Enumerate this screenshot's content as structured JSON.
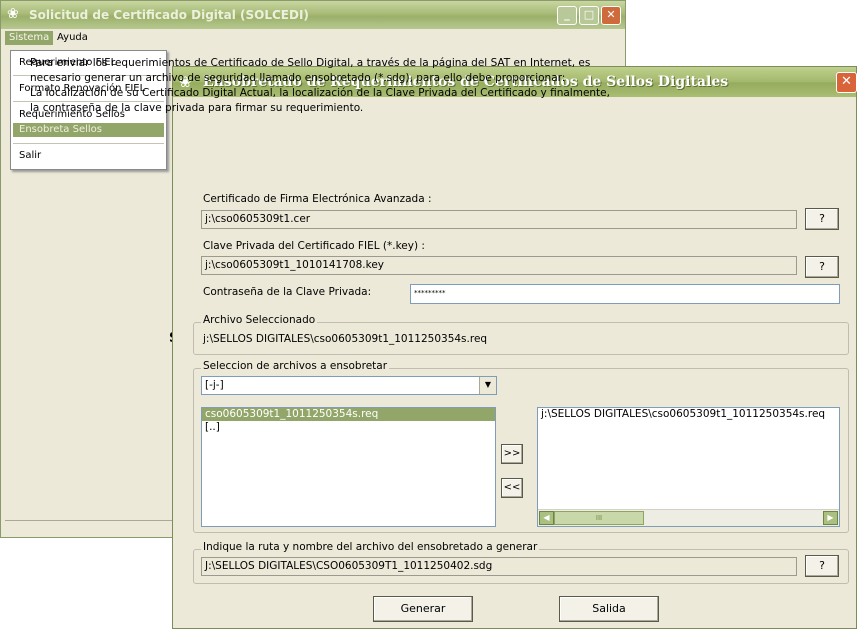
{
  "background_window": {
    "title": "Solicitud de Certificado Digital (SOLCEDI)",
    "menu": [
      {
        "label": "Sistema"
      },
      {
        "label": "Ayuda"
      }
    ],
    "dropdown_items": [
      {
        "label": "Requerimiento FIEL"
      },
      {
        "label": "Formato Renovación FIEL"
      },
      {
        "label": "Requerimiento Sellos"
      },
      {
        "label": "Ensobreta Sellos"
      },
      {
        "label": "Salir"
      }
    ],
    "stray_text": "S"
  },
  "dialog": {
    "title": "Ensobretado de Requerimientos de Certificados de Sellos Digitales",
    "description_lines": [
      "Para enviar  los requerimientos  de Certificado de Sello  Digital, a través de la página del SAT en  Internet, es",
      "necesario generar un archivo de seguridad llamado ensobretado (*.sdg),  para ello debe proporcionar:",
      "La localización de su Certificado Digital Actual, la localización de la Clave Privada  del Certificado y finalmente,",
      "la contraseña de la clave privada para firmar su requerimiento."
    ],
    "cert_label": "Certificado de Firma Electrónica Avanzada :",
    "cert_value": "j:\\cso0605309t1.cer",
    "key_label": "Clave Privada del Certificado FIEL (*.key) :",
    "key_value": "j:\\cso0605309t1_1010141708.key",
    "password_label": "Contraseña de la Clave Privada:",
    "password_value": "*********",
    "browse_label": "?",
    "selected_group_title": "Archivo Seleccionado",
    "selected_file": "j:\\SELLOS DIGITALES\\cso0605309t1_1011250354s.req",
    "selection_group_title": "Seleccion de archivos a ensobretar",
    "drive_value": "[-j-]",
    "left_list": [
      {
        "label": "cso0605309t1_1011250354s.req",
        "selected": true
      },
      {
        "label": "[..]",
        "selected": false
      }
    ],
    "right_list": [
      {
        "label": "j:\\SELLOS DIGITALES\\cso0605309t1_1011250354s.req"
      }
    ],
    "add_button": ">>",
    "remove_button": "<<",
    "scroll_thumb_text": "III",
    "output_group_title": "Indique la ruta y nombre del archivo del ensobretado a generar",
    "output_value": "J:\\SELLOS DIGITALES\\CSO0605309T1_1011250402.sdg",
    "generate_button": "Generar",
    "exit_button": "Salida"
  }
}
